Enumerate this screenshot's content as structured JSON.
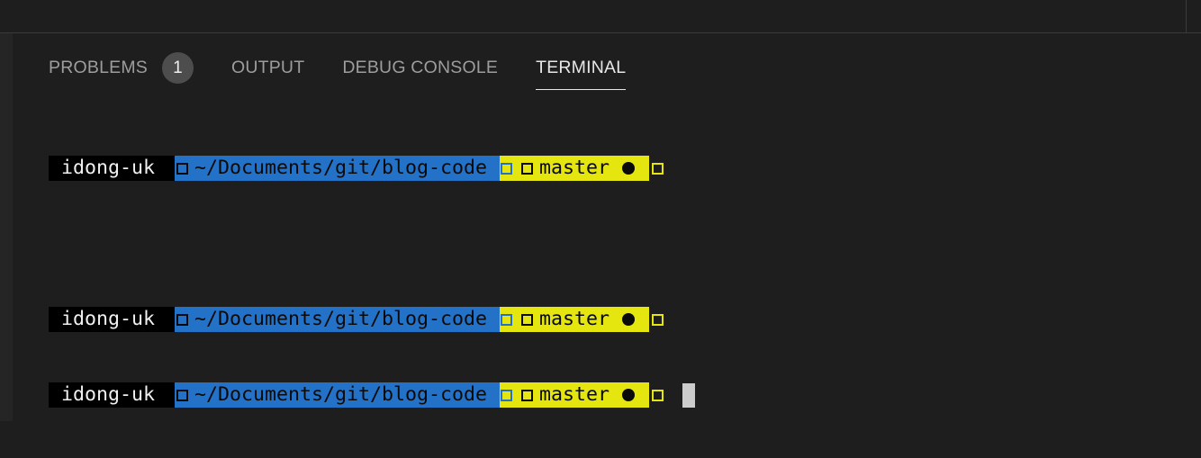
{
  "panel": {
    "tabs": [
      {
        "label": "PROBLEMS",
        "active": false,
        "badge": "1"
      },
      {
        "label": "OUTPUT",
        "active": false
      },
      {
        "label": "DEBUG CONSOLE",
        "active": false
      },
      {
        "label": "TERMINAL",
        "active": true
      }
    ]
  },
  "terminal": {
    "prompts": [
      {
        "user": "idong-uk",
        "path": "~/Documents/git/blog-code",
        "branch": "master"
      },
      {
        "user": "idong-uk",
        "path": "~/Documents/git/blog-code",
        "branch": "master"
      },
      {
        "user": "idong-uk",
        "path": "~/Documents/git/blog-code",
        "branch": "master"
      }
    ]
  },
  "colors": {
    "background": "#1e1e1e",
    "user_segment": "#000000",
    "path_segment": "#2472c8",
    "git_segment": "#e5e510",
    "badge": "#4d4d4d",
    "cursor": "#cccccc"
  }
}
